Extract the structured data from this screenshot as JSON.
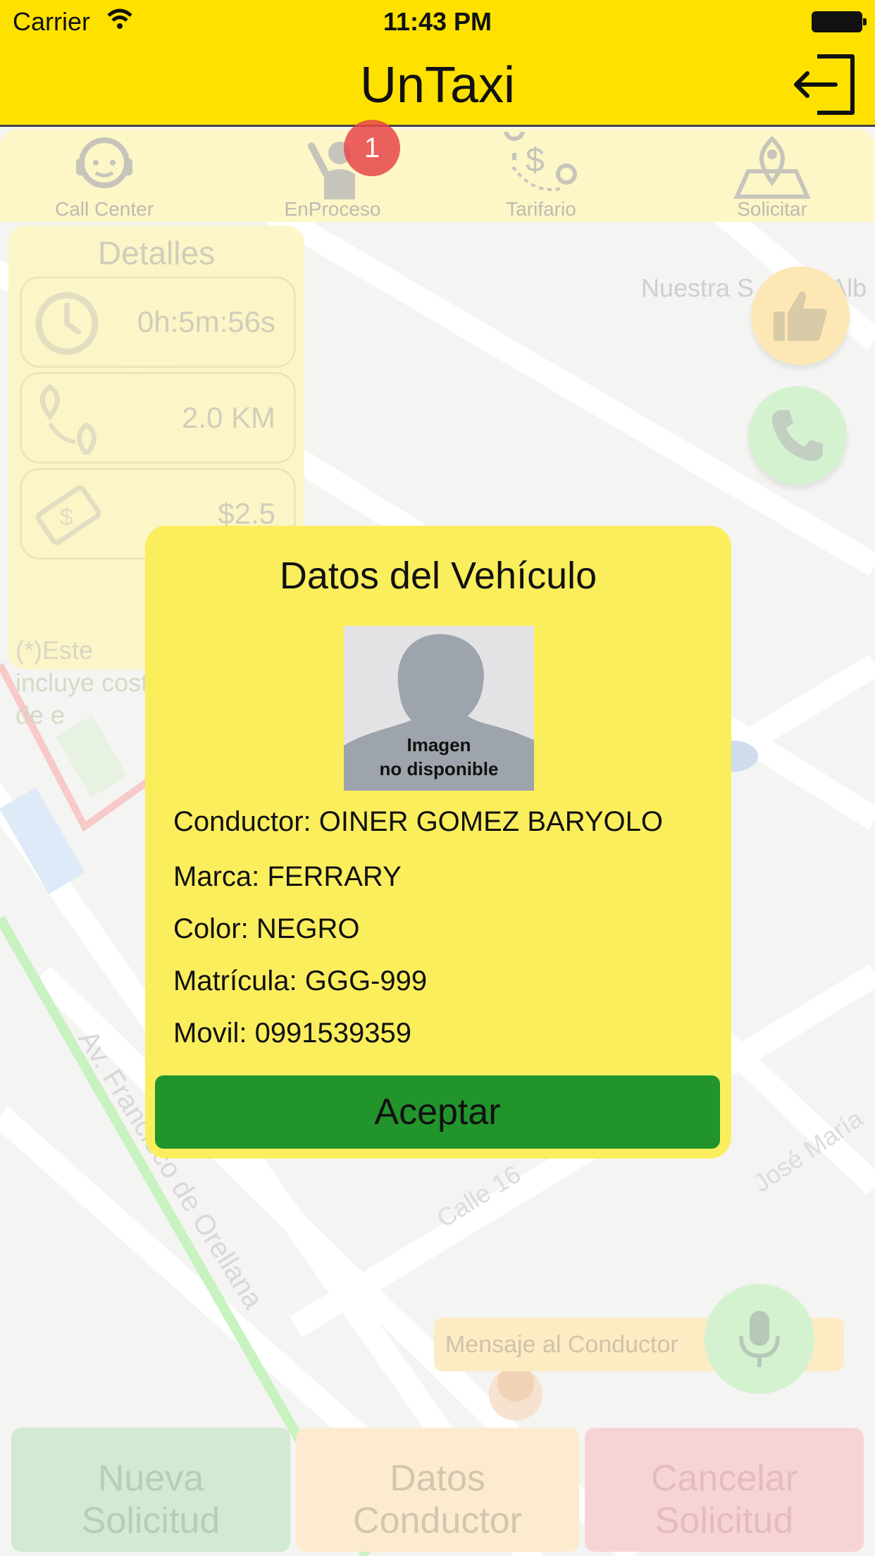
{
  "status_bar": {
    "carrier": "Carrier",
    "time": "11:43 PM"
  },
  "nav": {
    "title": "UnTaxi"
  },
  "tabs": [
    {
      "label": "Call Center",
      "icon": "headset-agent-icon"
    },
    {
      "label": "EnProceso",
      "icon": "waving-person-icon"
    },
    {
      "label": "Tarifario",
      "icon": "route-price-icon"
    },
    {
      "label": "Solicitar",
      "icon": "map-pin-icon"
    }
  ],
  "badge": "1",
  "details": {
    "title": "Detalles",
    "time": "0h:5m:56s",
    "distance": "2.0 KM",
    "price": "$2.5",
    "note": "(*)Este incluye cost de e"
  },
  "map_labels": {
    "place": "Nuestra S de La Alb",
    "street_1": "Av. Francisco de Orellana",
    "street_2": "Calle 16",
    "street_3": "José María"
  },
  "message": {
    "placeholder": "Mensaje al Conductor"
  },
  "bottom_buttons": {
    "new_line1": "Nueva",
    "new_line2": "Solicitud",
    "driver_line1": "Datos",
    "driver_line2": "Conductor",
    "cancel_line1": "Cancelar",
    "cancel_line2": "Solicitud"
  },
  "modal": {
    "title": "Datos del Vehículo",
    "photo_caption_1": "Imagen",
    "photo_caption_2": "no disponible",
    "driver": "Conductor: OINER GOMEZ BARYOLO",
    "brand": "Marca: FERRARY",
    "color": "Color: NEGRO",
    "plate": "Matrícula: GGG-999",
    "mobile": "Movil: 0991539359",
    "accept": "Aceptar"
  },
  "colors": {
    "brand_yellow": "#ffe100",
    "modal_yellow": "#fbee5d",
    "accept_green": "#22942c"
  }
}
